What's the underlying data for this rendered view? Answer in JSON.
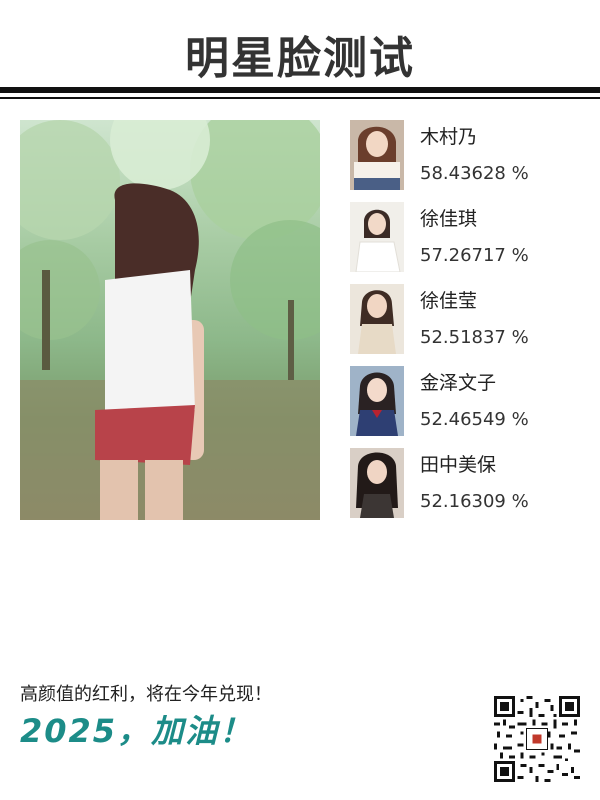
{
  "header": {
    "title": "明星脸测试"
  },
  "results": [
    {
      "name": "木村乃",
      "score": "58.43628 %"
    },
    {
      "name": "徐佳琪",
      "score": "57.26717 %"
    },
    {
      "name": "徐佳莹",
      "score": "52.51837 %"
    },
    {
      "name": "金泽文子",
      "score": "52.46549 %"
    },
    {
      "name": "田中美保",
      "score": "52.16309 %"
    }
  ],
  "footer": {
    "slogan": "高颜值的红利，将在今年兑现！",
    "cheer": "2025，加油！"
  },
  "colors": {
    "accent": "#1c8c88",
    "rule": "#111111"
  }
}
